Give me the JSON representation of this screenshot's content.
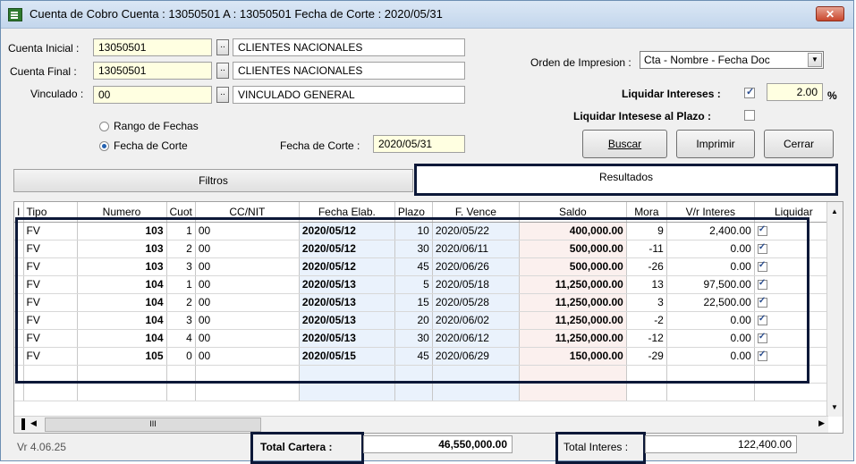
{
  "window": {
    "title": "Cuenta de Cobro   Cuenta : 13050501 A : 13050501   Fecha de Corte : 2020/05/31",
    "close_label": "✕"
  },
  "form": {
    "cuenta_inicial_label": "Cuenta Inicial :",
    "cuenta_inicial_value": "13050501",
    "cuenta_inicial_name": "CLIENTES NACIONALES",
    "cuenta_final_label": "Cuenta Final :",
    "cuenta_final_value": "13050501",
    "cuenta_final_name": "CLIENTES NACIONALES",
    "vinculado_label": "Vinculado :",
    "vinculado_value": "00",
    "vinculado_name": "VINCULADO GENERAL",
    "lookup_label": "..",
    "rango_label": "Rango de Fechas",
    "corte_label": "Fecha de Corte",
    "fecha_corte_label": "Fecha de Corte :",
    "fecha_corte_value": "2020/05/31",
    "orden_label": "Orden de Impresion :",
    "orden_value": "Cta - Nombre - Fecha Doc",
    "liquidar_label": "Liquidar Intereses :",
    "liquidar_rate": "2.00",
    "percent": "%",
    "plazo_label": "Liquidar Intesese al Plazo :"
  },
  "buttons": {
    "buscar": "Buscar",
    "imprimir": "Imprimir",
    "cerrar": "Cerrar"
  },
  "tabs": {
    "filtros": "Filtros",
    "resultados": "Resultados"
  },
  "grid": {
    "headers": [
      "I",
      "Tipo",
      "Numero",
      "Cuot",
      "CC/NIT",
      "Fecha Elab.",
      "Plazo",
      "F. Vence",
      "Saldo",
      "Mora",
      "V/r Interes",
      "Liquidar"
    ],
    "rows": [
      [
        "FV",
        "103",
        "1",
        "00",
        "2020/05/12",
        "10",
        "2020/05/22",
        "400,000.00",
        "9",
        "2,400.00"
      ],
      [
        "FV",
        "103",
        "2",
        "00",
        "2020/05/12",
        "30",
        "2020/06/11",
        "500,000.00",
        "-11",
        "0.00"
      ],
      [
        "FV",
        "103",
        "3",
        "00",
        "2020/05/12",
        "45",
        "2020/06/26",
        "500,000.00",
        "-26",
        "0.00"
      ],
      [
        "FV",
        "104",
        "1",
        "00",
        "2020/05/13",
        "5",
        "2020/05/18",
        "11,250,000.00",
        "13",
        "97,500.00"
      ],
      [
        "FV",
        "104",
        "2",
        "00",
        "2020/05/13",
        "15",
        "2020/05/28",
        "11,250,000.00",
        "3",
        "22,500.00"
      ],
      [
        "FV",
        "104",
        "3",
        "00",
        "2020/05/13",
        "20",
        "2020/06/02",
        "11,250,000.00",
        "-2",
        "0.00"
      ],
      [
        "FV",
        "104",
        "4",
        "00",
        "2020/05/13",
        "30",
        "2020/06/12",
        "11,250,000.00",
        "-12",
        "0.00"
      ],
      [
        "FV",
        "105",
        "0",
        "00",
        "2020/05/15",
        "45",
        "2020/06/29",
        "150,000.00",
        "-29",
        "0.00"
      ]
    ],
    "hscroll_thumb": "III"
  },
  "footer": {
    "version": "Vr 4.06.25",
    "total_cartera_label": "Total  Cartera :",
    "total_cartera_value": "46,550,000.00",
    "total_interes_label": "Total Interes :",
    "total_interes_value": "122,400.00"
  }
}
